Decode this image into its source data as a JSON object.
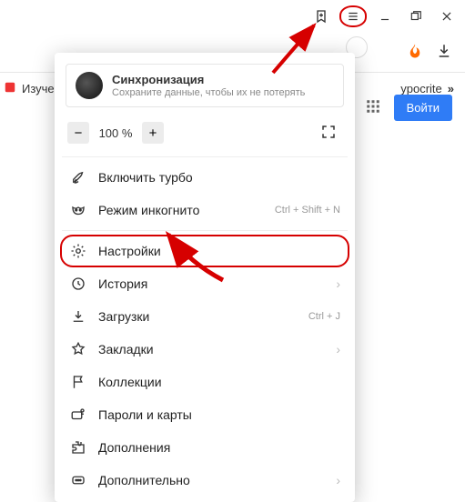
{
  "window": {
    "bookmark_icon": "bookmark",
    "hamburger": "menu",
    "minimize": "minimize",
    "maximize": "maximize",
    "close": "close"
  },
  "toolbar": {
    "flame": "flame",
    "download": "download"
  },
  "bookmarks": {
    "left_item": "Изуче",
    "right_item": "ypocrite",
    "more": "»"
  },
  "login": {
    "apps_icon": "apps-grid",
    "button": "Войти"
  },
  "menu": {
    "sync": {
      "title": "Синхронизация",
      "subtitle": "Сохраните данные, чтобы их не потерять"
    },
    "zoom": {
      "minus": "−",
      "value": "100 %",
      "plus": "+",
      "fullscreen": "fullscreen"
    },
    "items": [
      {
        "icon": "rocket",
        "label": "Включить турбо",
        "hint": "",
        "chev": ""
      },
      {
        "icon": "mask",
        "label": "Режим инкогнито",
        "hint": "Ctrl + Shift + N",
        "chev": ""
      },
      {
        "sep": true
      },
      {
        "icon": "gear",
        "label": "Настройки",
        "hint": "",
        "chev": "",
        "hl": true
      },
      {
        "icon": "clock",
        "label": "История",
        "hint": "",
        "chev": "›"
      },
      {
        "icon": "download",
        "label": "Загрузки",
        "hint": "Ctrl + J",
        "chev": ""
      },
      {
        "icon": "star",
        "label": "Закладки",
        "hint": "",
        "chev": "›"
      },
      {
        "icon": "flag",
        "label": "Коллекции",
        "hint": "",
        "chev": ""
      },
      {
        "icon": "key",
        "label": "Пароли и карты",
        "hint": "",
        "chev": ""
      },
      {
        "icon": "puzzle",
        "label": "Дополнения",
        "hint": "",
        "chev": ""
      },
      {
        "icon": "dots",
        "label": "Дополнительно",
        "hint": "",
        "chev": "›"
      }
    ]
  }
}
